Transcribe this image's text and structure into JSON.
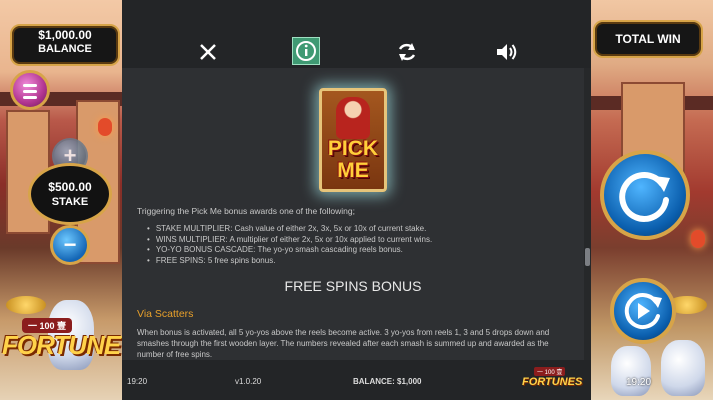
{
  "hud": {
    "balance_amount": "$1,000.00",
    "balance_label": "BALANCE",
    "total_win_label": "TOTAL WIN",
    "stake_amount": "$500.00",
    "stake_label": "STAKE",
    "plus_symbol": "+",
    "minus_symbol": "−",
    "clock": "19:20"
  },
  "logo": {
    "small_text": "一 100 壹",
    "word": "FORTUNE"
  },
  "panel": {
    "toolbar_icons": [
      "close-icon",
      "info-icon",
      "refresh-icon",
      "sound-icon"
    ],
    "active_tab": "info",
    "accent_color": "#3f9a73",
    "card": {
      "line1": "PICK",
      "line2": "ME"
    },
    "intro": "Triggering the Pick Me bonus awards one of the following;",
    "bullets": [
      "STAKE MULTIPLIER: Cash value of either 2x, 3x, 5x or 10x of current stake.",
      "WINS MULTIPLIER: A multiplier of either 2x, 5x or 10x applied to current wins.",
      "YO-YO BONUS CASCADE: The yo-yo smash cascading reels bonus.",
      "FREE SPINS: 5 free spins bonus."
    ],
    "section_title": "FREE SPINS BONUS",
    "sub_title": "Via Scatters",
    "paragraph": "When bonus is activated, all 5 yo-yos above the reels become active. 3 yo-yos from reels 1, 3 and 5 drops down and smashes through the first wooden layer. The numbers revealed after each smash is summed up and awarded as the number of free spins.",
    "sub_title_color": "#e8a02b"
  },
  "footer": {
    "time": "19:20",
    "version": "v1.0.20",
    "balance": "BALANCE: $1,000",
    "logo_word": "FORTUNES",
    "logo_small": "一 100 壹"
  }
}
